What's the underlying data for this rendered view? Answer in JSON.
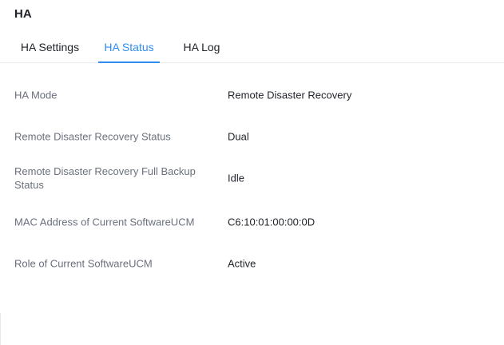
{
  "header": {
    "title": "HA"
  },
  "tabs": [
    {
      "label": "HA Settings",
      "active": false
    },
    {
      "label": "HA Status",
      "active": true
    },
    {
      "label": "HA Log",
      "active": false
    }
  ],
  "colors": {
    "accent": "#2f8ef0",
    "label_text": "#6a707c",
    "value_text": "#1f2329",
    "divider": "#e8eaef"
  },
  "status": {
    "rows": [
      {
        "label": "HA Mode",
        "value": "Remote Disaster Recovery"
      },
      {
        "label": "Remote Disaster Recovery Status",
        "value": "Dual"
      },
      {
        "label": "Remote Disaster Recovery Full Backup Status",
        "value": "Idle"
      },
      {
        "label": "MAC Address of Current SoftwareUCM",
        "value": "C6:10:01:00:00:0D"
      },
      {
        "label": "Role of Current SoftwareUCM",
        "value": "Active"
      }
    ]
  }
}
